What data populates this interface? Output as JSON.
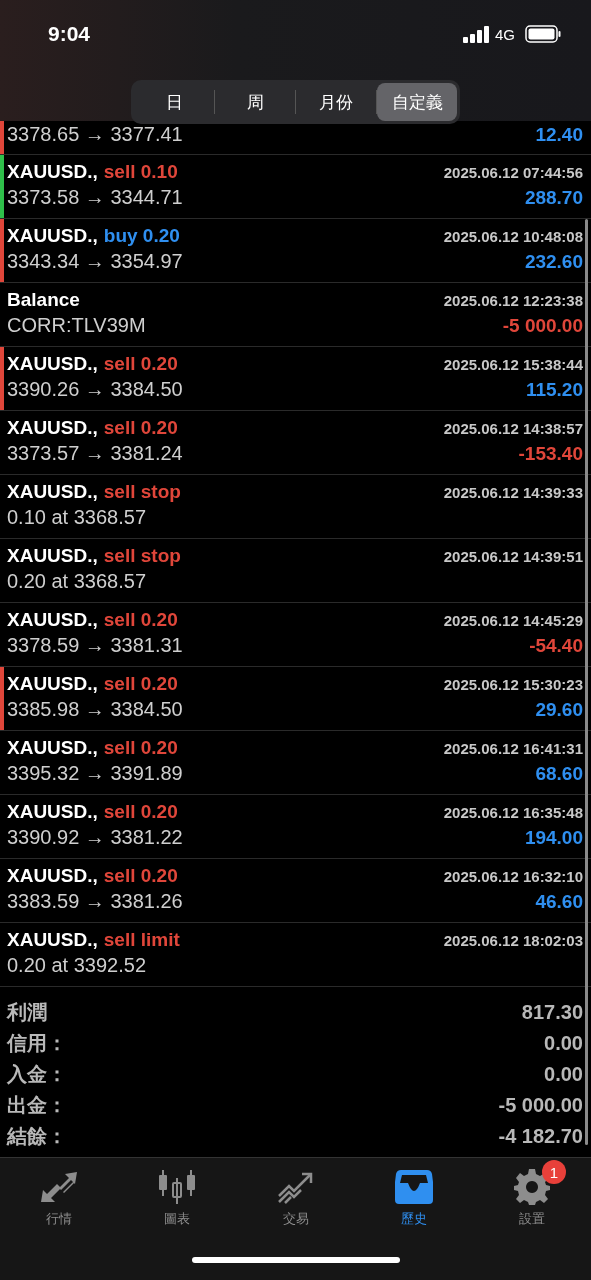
{
  "status_bar": {
    "time": "9:04",
    "network": "4G"
  },
  "period_tabs": [
    {
      "label": "日",
      "selected": false
    },
    {
      "label": "周",
      "selected": false
    },
    {
      "label": "月份",
      "selected": false
    },
    {
      "label": "自定義",
      "selected": true
    }
  ],
  "partial_row": {
    "prices": "3378.65 → 3377.41",
    "profit": "12.40",
    "negative": false,
    "color": "#e0463a"
  },
  "deals": [
    {
      "symbol": "XAUUSD.,",
      "action": "sell 0.10",
      "kind": "sell",
      "time": "2025.06.12 07:44:56",
      "prices": "3373.58 → 3344.71",
      "profit": "288.70",
      "negative": false,
      "color": "#2fbf4a"
    },
    {
      "symbol": "XAUUSD.,",
      "action": "buy 0.20",
      "kind": "buy",
      "time": "2025.06.12 10:48:08",
      "prices": "3343.34 → 3354.97",
      "profit": "232.60",
      "negative": false,
      "color": "#e0463a"
    },
    {
      "symbol": "Balance",
      "kind": "balance",
      "time": "2025.06.12 12:23:38",
      "prices": "CORR:TLV39M",
      "profit": "-5 000.00",
      "negative": true
    },
    {
      "symbol": "XAUUSD.,",
      "action": "sell 0.20",
      "kind": "sell",
      "time": "2025.06.12 15:38:44",
      "prices": "3390.26 → 3384.50",
      "profit": "115.20",
      "negative": false,
      "color": "#e0463a"
    },
    {
      "symbol": "XAUUSD.,",
      "action": "sell 0.20",
      "kind": "sell",
      "time": "2025.06.12 14:38:57",
      "prices": "3373.57 → 3381.24",
      "profit": "-153.40",
      "negative": true
    },
    {
      "symbol": "XAUUSD.,",
      "action": "sell stop",
      "kind": "sell",
      "time": "2025.06.12 14:39:33",
      "prices": "0.10 at 3368.57"
    },
    {
      "symbol": "XAUUSD.,",
      "action": "sell stop",
      "kind": "sell",
      "time": "2025.06.12 14:39:51",
      "prices": "0.20 at 3368.57"
    },
    {
      "symbol": "XAUUSD.,",
      "action": "sell 0.20",
      "kind": "sell",
      "time": "2025.06.12 14:45:29",
      "prices": "3378.59 → 3381.31",
      "profit": "-54.40",
      "negative": true
    },
    {
      "symbol": "XAUUSD.,",
      "action": "sell 0.20",
      "kind": "sell",
      "time": "2025.06.12 15:30:23",
      "prices": "3385.98 → 3384.50",
      "profit": "29.60",
      "negative": false,
      "color": "#e0463a"
    },
    {
      "symbol": "XAUUSD.,",
      "action": "sell 0.20",
      "kind": "sell",
      "time": "2025.06.12 16:41:31",
      "prices": "3395.32 → 3391.89",
      "profit": "68.60",
      "negative": false
    },
    {
      "symbol": "XAUUSD.,",
      "action": "sell 0.20",
      "kind": "sell",
      "time": "2025.06.12 16:35:48",
      "prices": "3390.92 → 3381.22",
      "profit": "194.00",
      "negative": false
    },
    {
      "symbol": "XAUUSD.,",
      "action": "sell 0.20",
      "kind": "sell",
      "time": "2025.06.12 16:32:10",
      "prices": "3383.59 → 3381.26",
      "profit": "46.60",
      "negative": false
    },
    {
      "symbol": "XAUUSD.,",
      "action": "sell limit",
      "kind": "sell",
      "time": "2025.06.12 18:02:03",
      "prices": "0.20 at 3392.52"
    }
  ],
  "summary": [
    {
      "label": "利潤",
      "value": "817.30"
    },
    {
      "label": "信用：",
      "value": "0.00"
    },
    {
      "label": "入金：",
      "value": "0.00"
    },
    {
      "label": "出金：",
      "value": "-5 000.00"
    },
    {
      "label": "結餘：",
      "value": "-4 182.70"
    }
  ],
  "tab_bar": [
    {
      "kind": "quotes",
      "label": "行情",
      "selected": false
    },
    {
      "kind": "chart",
      "label": "圖表",
      "selected": false
    },
    {
      "kind": "trade",
      "label": "交易",
      "selected": false
    },
    {
      "kind": "history",
      "label": "歷史",
      "selected": true
    },
    {
      "kind": "settings",
      "label": "設置",
      "selected": false,
      "badge": "1"
    }
  ]
}
